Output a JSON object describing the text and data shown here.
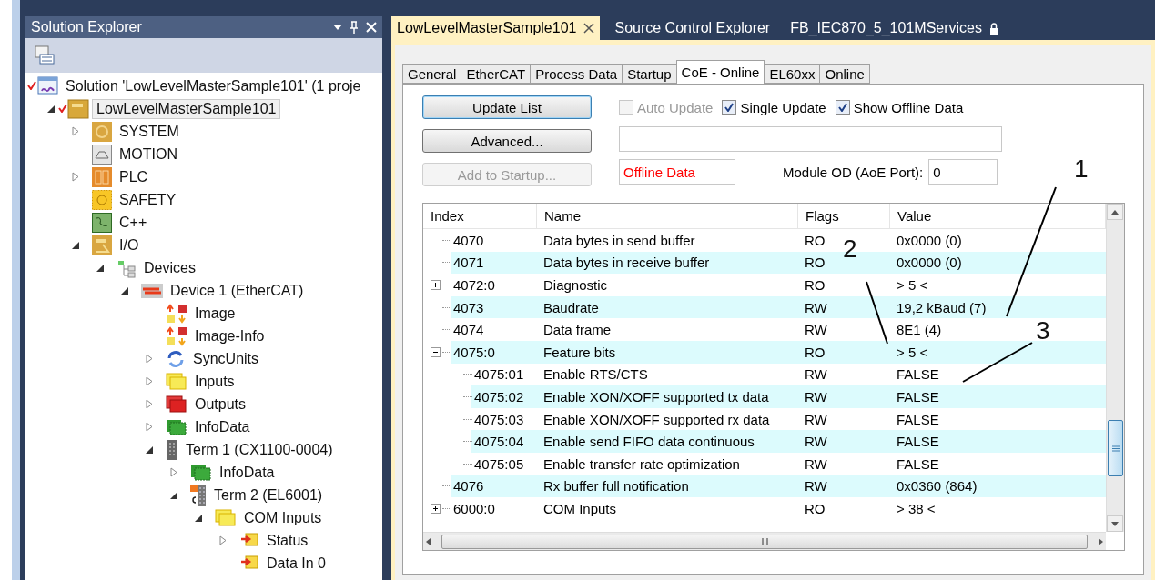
{
  "solution_explorer": {
    "title": "Solution Explorer",
    "solution": {
      "label": "Solution 'LowLevelMasterSample101' (1 proje",
      "checked": true
    },
    "tree": [
      {
        "label": "LowLevelMasterSample101",
        "kind": "project",
        "expanded": true,
        "checked": true,
        "selected": true,
        "children": [
          {
            "label": "SYSTEM",
            "kind": "system",
            "expanded": false,
            "selected": false
          },
          {
            "label": "MOTION",
            "kind": "motion",
            "selected": false
          },
          {
            "label": "PLC",
            "kind": "plc",
            "expanded": false,
            "selected": false
          },
          {
            "label": "SAFETY",
            "kind": "safety",
            "selected": false
          },
          {
            "label": "C++",
            "kind": "cpp",
            "selected": false
          },
          {
            "label": "I/O",
            "kind": "io",
            "expanded": true,
            "selected": false,
            "children": [
              {
                "label": "Devices",
                "kind": "devices",
                "expanded": true,
                "selected": false,
                "children": [
                  {
                    "label": "Device 1 (EtherCAT)",
                    "kind": "device",
                    "expanded": true,
                    "selected": false,
                    "children": [
                      {
                        "label": "Image",
                        "kind": "image",
                        "selected": false
                      },
                      {
                        "label": "Image-Info",
                        "kind": "image",
                        "selected": false
                      },
                      {
                        "label": "SyncUnits",
                        "kind": "sync",
                        "expanded": false,
                        "selected": false
                      },
                      {
                        "label": "Inputs",
                        "kind": "inputs",
                        "expanded": false,
                        "selected": false
                      },
                      {
                        "label": "Outputs",
                        "kind": "outputs",
                        "expanded": false,
                        "selected": false
                      },
                      {
                        "label": "InfoData",
                        "kind": "infodata",
                        "expanded": false,
                        "selected": false
                      },
                      {
                        "label": "Term 1 (CX1100-0004)",
                        "kind": "terminal",
                        "expanded": true,
                        "selected": false,
                        "children": [
                          {
                            "label": "InfoData",
                            "kind": "infodata",
                            "expanded": false,
                            "selected": false
                          },
                          {
                            "label": "Term 2 (EL6001)",
                            "kind": "terminal-c",
                            "expanded": true,
                            "selected": false,
                            "children": [
                              {
                                "label": "COM Inputs",
                                "kind": "inputs",
                                "expanded": true,
                                "selected": false,
                                "children": [
                                  {
                                    "label": "Status",
                                    "kind": "status",
                                    "expanded": false,
                                    "selected": false
                                  },
                                  {
                                    "label": "Data In 0",
                                    "kind": "status",
                                    "selected": false
                                  }
                                ]
                              }
                            ]
                          }
                        ]
                      }
                    ]
                  }
                ]
              }
            ]
          }
        ]
      }
    ]
  },
  "doc_tabs": [
    {
      "label": "LowLevelMasterSample101",
      "selected": true,
      "closable": true,
      "locked": false
    },
    {
      "label": "Source Control Explorer",
      "selected": false,
      "closable": false,
      "locked": false
    },
    {
      "label": "FB_IEC870_5_101MServices",
      "selected": false,
      "closable": false,
      "locked": true
    }
  ],
  "tabs": [
    {
      "label": "General",
      "selected": false
    },
    {
      "label": "EtherCAT",
      "selected": false
    },
    {
      "label": "Process Data",
      "selected": false
    },
    {
      "label": "Startup",
      "selected": false
    },
    {
      "label": "CoE - Online",
      "selected": true
    },
    {
      "label": "EL60xx",
      "selected": false
    },
    {
      "label": "Online",
      "selected": false
    }
  ],
  "buttons": [
    {
      "label": "Update List",
      "focused": true,
      "disabled": false
    },
    {
      "label": "Advanced...",
      "focused": false,
      "disabled": false
    },
    {
      "label": "Add to Startup...",
      "focused": false,
      "disabled": true
    }
  ],
  "checkboxes": [
    {
      "label": "Auto Update",
      "checked": false,
      "disabled": true
    },
    {
      "label": "Single Update",
      "checked": true,
      "disabled": false
    },
    {
      "label": "Show Offline Data",
      "checked": true,
      "disabled": false
    }
  ],
  "status_field": {
    "value": "Offline Data"
  },
  "module_od": {
    "label": "Module OD (AoE Port):",
    "value": "0"
  },
  "table": {
    "columns": [
      "Index",
      "Name",
      "Flags",
      "Value"
    ],
    "rows": [
      {
        "index": "4070",
        "name": "Data bytes in send buffer",
        "flags": "RO",
        "value": "0x0000 (0)"
      },
      {
        "index": "4071",
        "name": "Data bytes in receive buffer",
        "flags": "RO",
        "value": "0x0000 (0)"
      },
      {
        "index": "4072:0",
        "name": "Diagnostic",
        "flags": "RO",
        "value": "> 5 <",
        "expanded": false
      },
      {
        "index": "4073",
        "name": "Baudrate",
        "flags": "RW",
        "value": "19,2 kBaud (7)"
      },
      {
        "index": "4074",
        "name": "Data frame",
        "flags": "RW",
        "value": "8E1 (4)"
      },
      {
        "index": "4075:0",
        "name": "Feature bits",
        "flags": "RO",
        "value": "> 5 <",
        "expanded": true,
        "children": [
          {
            "index": "4075:01",
            "name": "Enable RTS/CTS",
            "flags": "RW",
            "value": "FALSE"
          },
          {
            "index": "4075:02",
            "name": "Enable  XON/XOFF supported tx data",
            "flags": "RW",
            "value": "FALSE"
          },
          {
            "index": "4075:03",
            "name": "Enable XON/XOFF supported rx data",
            "flags": "RW",
            "value": "FALSE"
          },
          {
            "index": "4075:04",
            "name": "Enable send FIFO data continuous",
            "flags": "RW",
            "value": "FALSE"
          },
          {
            "index": "4075:05",
            "name": "Enable transfer rate optimization",
            "flags": "RW",
            "value": "FALSE"
          }
        ]
      },
      {
        "index": "4076",
        "name": "Rx buffer full notification",
        "flags": "RW",
        "value": "0x0360 (864)"
      },
      {
        "index": "6000:0",
        "name": "COM Inputs",
        "flags": "RO",
        "value": "> 38 <",
        "expanded": false
      }
    ]
  },
  "callouts": [
    {
      "label": "1"
    },
    {
      "label": "2"
    },
    {
      "label": "3"
    }
  ]
}
